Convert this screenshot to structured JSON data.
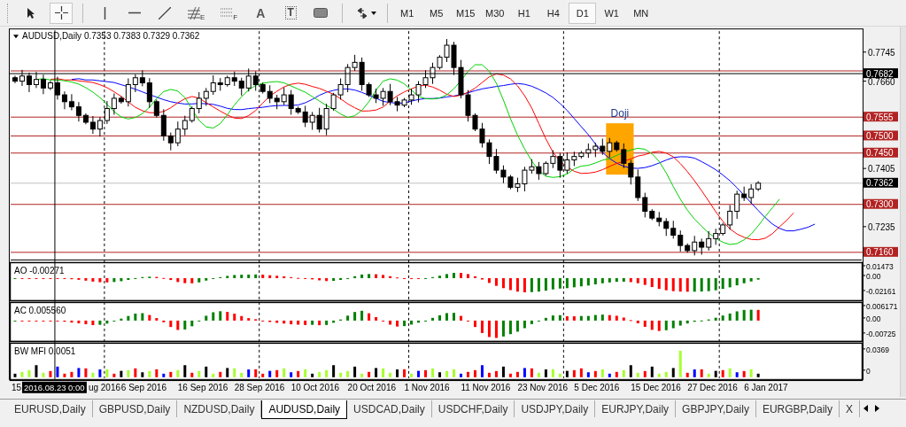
{
  "toolbar": {
    "tools": [
      {
        "kind": "cursor",
        "selected": false
      },
      {
        "kind": "crosshair",
        "selected": true
      },
      {
        "kind": "vline",
        "selected": false
      },
      {
        "kind": "hline",
        "selected": false
      },
      {
        "kind": "trendline",
        "selected": false
      },
      {
        "kind": "fibo",
        "label": "E",
        "selected": false
      },
      {
        "kind": "grid",
        "label": "F",
        "selected": false
      },
      {
        "kind": "text",
        "label": "A",
        "selected": false
      },
      {
        "kind": "textlabel",
        "label": "T",
        "selected": false
      },
      {
        "kind": "rectangle",
        "selected": false
      },
      {
        "kind": "arrows",
        "selected": false
      }
    ],
    "timeframes": [
      {
        "label": "M1",
        "selected": false
      },
      {
        "label": "M5",
        "selected": false
      },
      {
        "label": "M15",
        "selected": false
      },
      {
        "label": "M30",
        "selected": false
      },
      {
        "label": "H1",
        "selected": false
      },
      {
        "label": "H4",
        "selected": false
      },
      {
        "label": "D1",
        "selected": true
      },
      {
        "label": "W1",
        "selected": false
      },
      {
        "label": "MN",
        "selected": false
      }
    ]
  },
  "chart": {
    "symbol_label": "AUDUSD,Daily",
    "ohlc": "0.7353 0.7383 0.7329 0.7362",
    "annotation": "Doji",
    "price_axis": [
      {
        "kind": "tick",
        "text": "0.7745"
      },
      {
        "kind": "crosshair",
        "text": "0.7682"
      },
      {
        "kind": "tick",
        "text": "0.7660"
      },
      {
        "kind": "level",
        "text": "0.7555"
      },
      {
        "kind": "level",
        "text": "0.7500"
      },
      {
        "kind": "level",
        "text": "0.7450"
      },
      {
        "kind": "tick",
        "text": "0.7405"
      },
      {
        "kind": "bid",
        "text": "0.7362"
      },
      {
        "kind": "level",
        "text": "0.7300"
      },
      {
        "kind": "tick",
        "text": "0.7235"
      },
      {
        "kind": "level",
        "text": "0.7160"
      }
    ],
    "time_axis": [
      "15",
      "ug 2016",
      "6 Sep 2016",
      "16 Sep 2016",
      "28 Sep 2016",
      "10 Oct 2016",
      "20 Oct 2016",
      "1 Nov 2016",
      "11 Nov 2016",
      "23 Nov 2016",
      "5 Dec 2016",
      "15 Dec 2016",
      "27 Dec 2016",
      "6 Jan 2017"
    ],
    "crosshair_time": "2016.08.23 0:00"
  },
  "indicators": [
    {
      "kind": "ao",
      "label": "AO -0.00271",
      "ticks": [
        "0.01473",
        "0.00",
        "-0.02161"
      ]
    },
    {
      "kind": "ac",
      "label": "AC 0.005560",
      "ticks": [
        "0.006171",
        "0.00",
        "-0.00725"
      ]
    },
    {
      "kind": "mfi",
      "label": "BW MFI 0.0051",
      "ticks": [
        "0.0369",
        "0"
      ]
    }
  ],
  "tabs": [
    {
      "label": "EURUSD,Daily",
      "selected": false
    },
    {
      "label": "GBPUSD,Daily",
      "selected": false
    },
    {
      "label": "NZDUSD,Daily",
      "selected": false
    },
    {
      "label": "AUDUSD,Daily",
      "selected": true
    },
    {
      "label": "USDCAD,Daily",
      "selected": false
    },
    {
      "label": "USDCHF,Daily",
      "selected": false
    },
    {
      "label": "USDJPY,Daily",
      "selected": false
    },
    {
      "label": "EURJPY,Daily",
      "selected": false
    },
    {
      "label": "GBPJPY,Daily",
      "selected": false
    },
    {
      "label": "EURGBP,Daily",
      "selected": false
    },
    {
      "label": "X",
      "selected": false
    }
  ]
}
